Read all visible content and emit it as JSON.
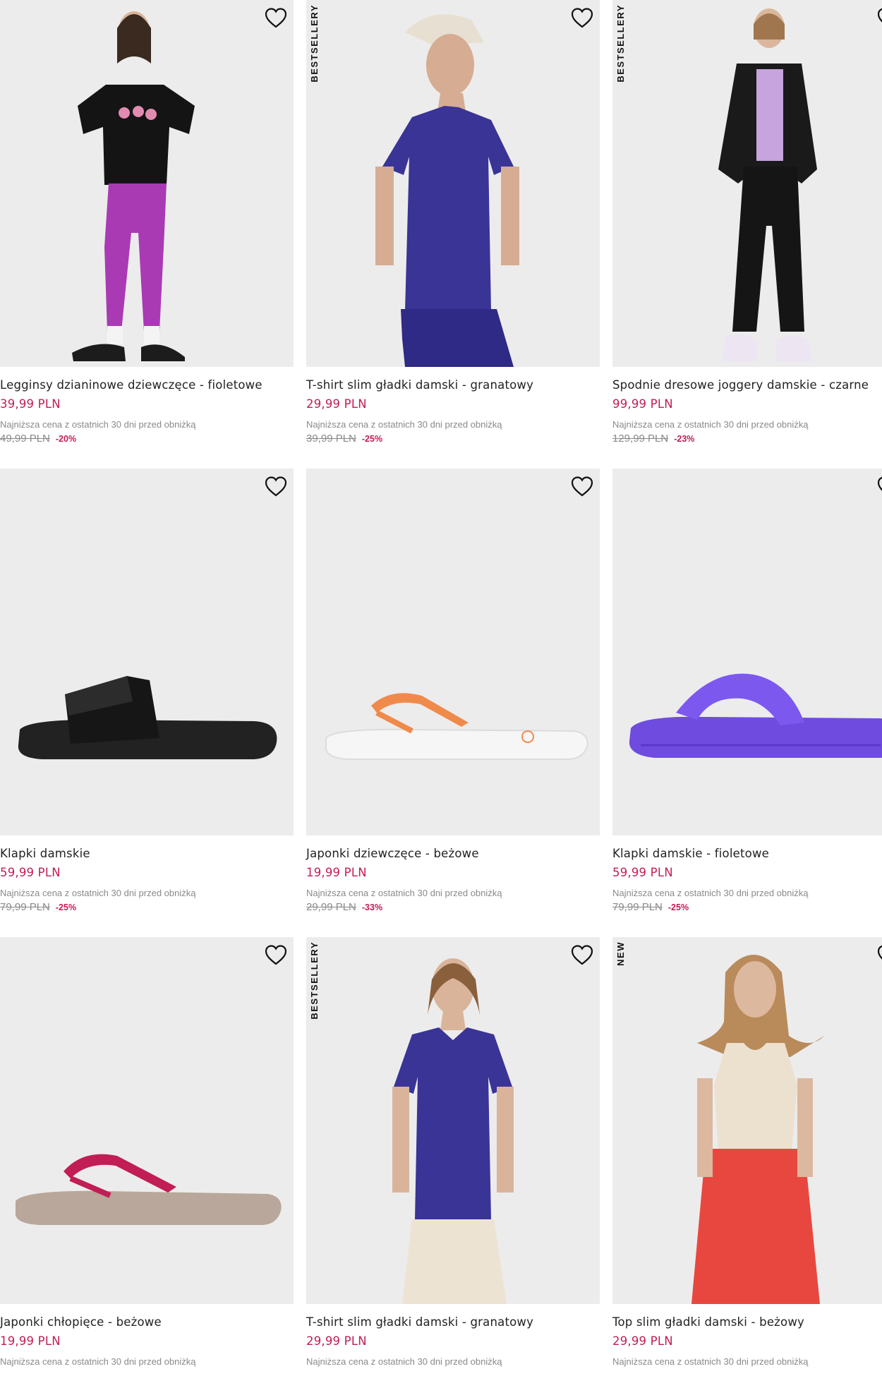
{
  "colors": {
    "price_accent": "#c01e54",
    "image_background": "#ececec",
    "muted_text": "#8a8a8a"
  },
  "products": [
    {
      "name": "Legginsy dzianinowe dziewczęce - fioletowe",
      "price": "39,99 PLN",
      "lowest_label": "Najniższa cena z ostatnich 30 dni przed obniżką",
      "old_price": "49,99 PLN",
      "discount": "-20%",
      "badge": "",
      "icon": "heart-icon"
    },
    {
      "name": "T-shirt slim gładki damski - granatowy",
      "price": "29,99 PLN",
      "lowest_label": "Najniższa cena z ostatnich 30 dni przed obniżką",
      "old_price": "39,99 PLN",
      "discount": "-25%",
      "badge": "BESTSELLERY",
      "icon": "heart-icon"
    },
    {
      "name": "Spodnie dresowe joggery damskie - czarne",
      "price": "99,99 PLN",
      "lowest_label": "Najniższa cena z ostatnich 30 dni przed obniżką",
      "old_price": "129,99 PLN",
      "discount": "-23%",
      "badge": "BESTSELLERY",
      "icon": "heart-icon"
    },
    {
      "name": "Klapki damskie",
      "price": "59,99 PLN",
      "lowest_label": "Najniższa cena z ostatnich 30 dni przed obniżką",
      "old_price": "79,99 PLN",
      "discount": "-25%",
      "badge": "",
      "icon": "heart-icon"
    },
    {
      "name": "Japonki dziewczęce - beżowe",
      "price": "19,99 PLN",
      "lowest_label": "Najniższa cena z ostatnich 30 dni przed obniżką",
      "old_price": "29,99 PLN",
      "discount": "-33%",
      "badge": "",
      "icon": "heart-icon"
    },
    {
      "name": "Klapki damskie - fioletowe",
      "price": "59,99 PLN",
      "lowest_label": "Najniższa cena z ostatnich 30 dni przed obniżką",
      "old_price": "79,99 PLN",
      "discount": "-25%",
      "badge": "",
      "icon": "heart-icon"
    },
    {
      "name": "Japonki chłopięce - beżowe",
      "price": "19,99 PLN",
      "lowest_label": "Najniższa cena z ostatnich 30 dni przed obniżką",
      "old_price": "",
      "discount": "",
      "badge": "",
      "icon": "heart-icon"
    },
    {
      "name": "T-shirt slim gładki damski - granatowy",
      "price": "29,99 PLN",
      "lowest_label": "Najniższa cena z ostatnich 30 dni przed obniżką",
      "old_price": "",
      "discount": "",
      "badge": "BESTSELLERY",
      "icon": "heart-icon"
    },
    {
      "name": "Top slim gładki damski - beżowy",
      "price": "29,99 PLN",
      "lowest_label": "Najniższa cena z ostatnich 30 dni przed obniżką",
      "old_price": "",
      "discount": "",
      "badge": "NEW",
      "icon": "heart-icon"
    }
  ]
}
